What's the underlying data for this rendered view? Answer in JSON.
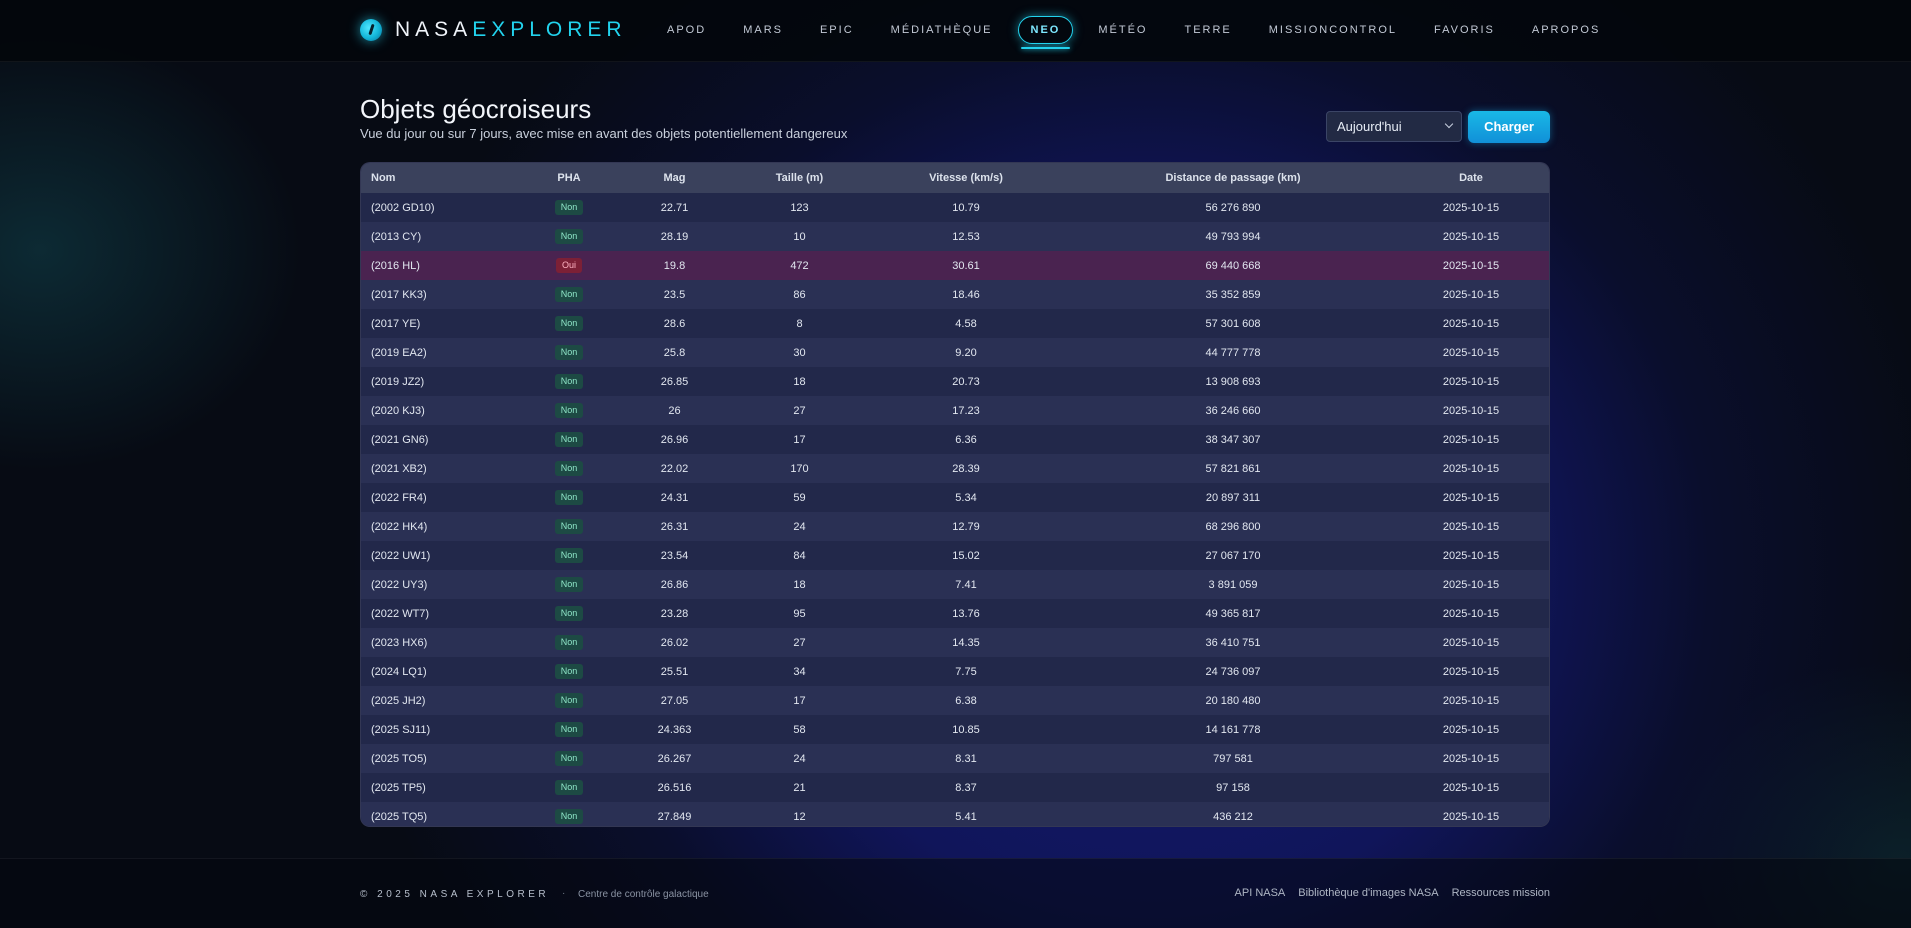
{
  "brand": {
    "part1": "NASA",
    "part2": "EXPLORER",
    "accent_color": "#22d3ee"
  },
  "nav": [
    {
      "label": "APOD",
      "active": false
    },
    {
      "label": "MARS",
      "active": false
    },
    {
      "label": "EPIC",
      "active": false
    },
    {
      "label": "MÉDIATHÈQUE",
      "active": false
    },
    {
      "label": "NEO",
      "active": true
    },
    {
      "label": "MÉTÉO",
      "active": false
    },
    {
      "label": "TERRE",
      "active": false
    },
    {
      "label": "MISSIONCONTROL",
      "active": false
    },
    {
      "label": "FAVORIS",
      "active": false
    },
    {
      "label": "APROPOS",
      "active": false
    }
  ],
  "page": {
    "title": "Objets géocroiseurs",
    "subtitle": "Vue du jour ou sur 7 jours, avec mise en avant des objets potentiellement dangereux"
  },
  "controls": {
    "range_selected": "Aujourd'hui",
    "load_label": "Charger"
  },
  "table": {
    "columns": [
      "Nom",
      "PHA",
      "Mag",
      "Taille (m)",
      "Vitesse (km/s)",
      "Distance de passage (km)",
      "Date"
    ],
    "rows": [
      [
        "(2002 GD10)",
        "Non",
        "22.71",
        "123",
        "10.79",
        "56 276 890",
        "2025-10-15"
      ],
      [
        "(2013 CY)",
        "Non",
        "28.19",
        "10",
        "12.53",
        "49 793 994",
        "2025-10-15"
      ],
      [
        "(2016 HL)",
        "Oui",
        "19.8",
        "472",
        "30.61",
        "69 440 668",
        "2025-10-15"
      ],
      [
        "(2017 KK3)",
        "Non",
        "23.5",
        "86",
        "18.46",
        "35 352 859",
        "2025-10-15"
      ],
      [
        "(2017 YE)",
        "Non",
        "28.6",
        "8",
        "4.58",
        "57 301 608",
        "2025-10-15"
      ],
      [
        "(2019 EA2)",
        "Non",
        "25.8",
        "30",
        "9.20",
        "44 777 778",
        "2025-10-15"
      ],
      [
        "(2019 JZ2)",
        "Non",
        "26.85",
        "18",
        "20.73",
        "13 908 693",
        "2025-10-15"
      ],
      [
        "(2020 KJ3)",
        "Non",
        "26",
        "27",
        "17.23",
        "36 246 660",
        "2025-10-15"
      ],
      [
        "(2021 GN6)",
        "Non",
        "26.96",
        "17",
        "6.36",
        "38 347 307",
        "2025-10-15"
      ],
      [
        "(2021 XB2)",
        "Non",
        "22.02",
        "170",
        "28.39",
        "57 821 861",
        "2025-10-15"
      ],
      [
        "(2022 FR4)",
        "Non",
        "24.31",
        "59",
        "5.34",
        "20 897 311",
        "2025-10-15"
      ],
      [
        "(2022 HK4)",
        "Non",
        "26.31",
        "24",
        "12.79",
        "68 296 800",
        "2025-10-15"
      ],
      [
        "(2022 UW1)",
        "Non",
        "23.54",
        "84",
        "15.02",
        "27 067 170",
        "2025-10-15"
      ],
      [
        "(2022 UY3)",
        "Non",
        "26.86",
        "18",
        "7.41",
        "3 891 059",
        "2025-10-15"
      ],
      [
        "(2022 WT7)",
        "Non",
        "23.28",
        "95",
        "13.76",
        "49 365 817",
        "2025-10-15"
      ],
      [
        "(2023 HX6)",
        "Non",
        "26.02",
        "27",
        "14.35",
        "36 410 751",
        "2025-10-15"
      ],
      [
        "(2024 LQ1)",
        "Non",
        "25.51",
        "34",
        "7.75",
        "24 736 097",
        "2025-10-15"
      ],
      [
        "(2025 JH2)",
        "Non",
        "27.05",
        "17",
        "6.38",
        "20 180 480",
        "2025-10-15"
      ],
      [
        "(2025 SJ11)",
        "Non",
        "24.363",
        "58",
        "10.85",
        "14 161 778",
        "2025-10-15"
      ],
      [
        "(2025 TO5)",
        "Non",
        "26.267",
        "24",
        "8.31",
        "797 581",
        "2025-10-15"
      ],
      [
        "(2025 TP5)",
        "Non",
        "26.516",
        "21",
        "8.37",
        "97 158",
        "2025-10-15"
      ],
      [
        "(2025 TQ5)",
        "Non",
        "27.849",
        "12",
        "5.41",
        "436 212",
        "2025-10-15"
      ]
    ],
    "hazard_value": "Oui"
  },
  "footer": {
    "copyright": "© 2025 NASA EXPLORER",
    "separator": "·",
    "tagline": "Centre de contrôle galactique",
    "links": [
      "API NASA",
      "Bibliothèque d'images NASA",
      "Ressources mission"
    ]
  }
}
